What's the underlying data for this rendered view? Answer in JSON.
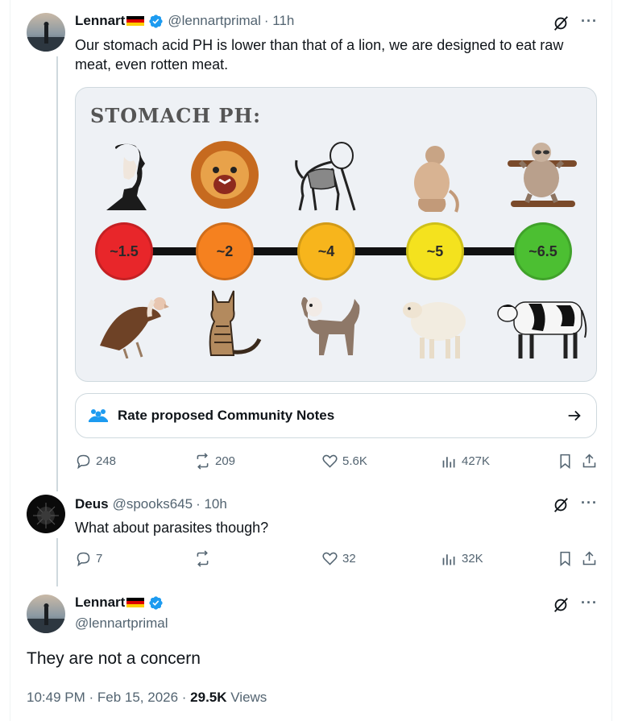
{
  "tweet1": {
    "name": "Lennart",
    "handle": "@lennartprimal",
    "time": "· 11h",
    "text": "Our stomach acid PH is lower than that of a lion, we are designed to eat raw meat, even rotten meat.",
    "media": {
      "title": "STOMACH PH:",
      "ph_values": [
        {
          "label": "~1.5",
          "color": "#e8262a"
        },
        {
          "label": "~2",
          "color": "#f5811f"
        },
        {
          "label": "~4",
          "color": "#f7b51c"
        },
        {
          "label": "~5",
          "color": "#f4e21e"
        },
        {
          "label": "~6.5",
          "color": "#4cbf32"
        }
      ],
      "top_animals": [
        "human-icon",
        "lion-icon",
        "baboon-icon",
        "monkey-icon",
        "sloth-icon"
      ],
      "bottom_animals": [
        "vulture-icon",
        "cat-icon",
        "dog-icon",
        "sheep-icon",
        "cow-icon"
      ]
    },
    "community_notes_label": "Rate proposed Community Notes",
    "stats": {
      "replies": "248",
      "reposts": "209",
      "likes": "5.6K",
      "views": "427K"
    }
  },
  "tweet2": {
    "name": "Deus",
    "handle": "@spooks645",
    "time": "· 10h",
    "text": "What about parasites though?",
    "stats": {
      "replies": "7",
      "reposts": "",
      "likes": "32",
      "views": "32K"
    }
  },
  "tweet3": {
    "name": "Lennart",
    "handle": "@lennartprimal",
    "text": "They are not a concern",
    "time": "10:49 PM · Feb 15, 2026 · ",
    "views_count": "29.5K",
    "views_label": " Views"
  },
  "colors": {
    "verified": "#1d9bf0",
    "text_secondary": "#536471",
    "border": "#cfd9de"
  }
}
